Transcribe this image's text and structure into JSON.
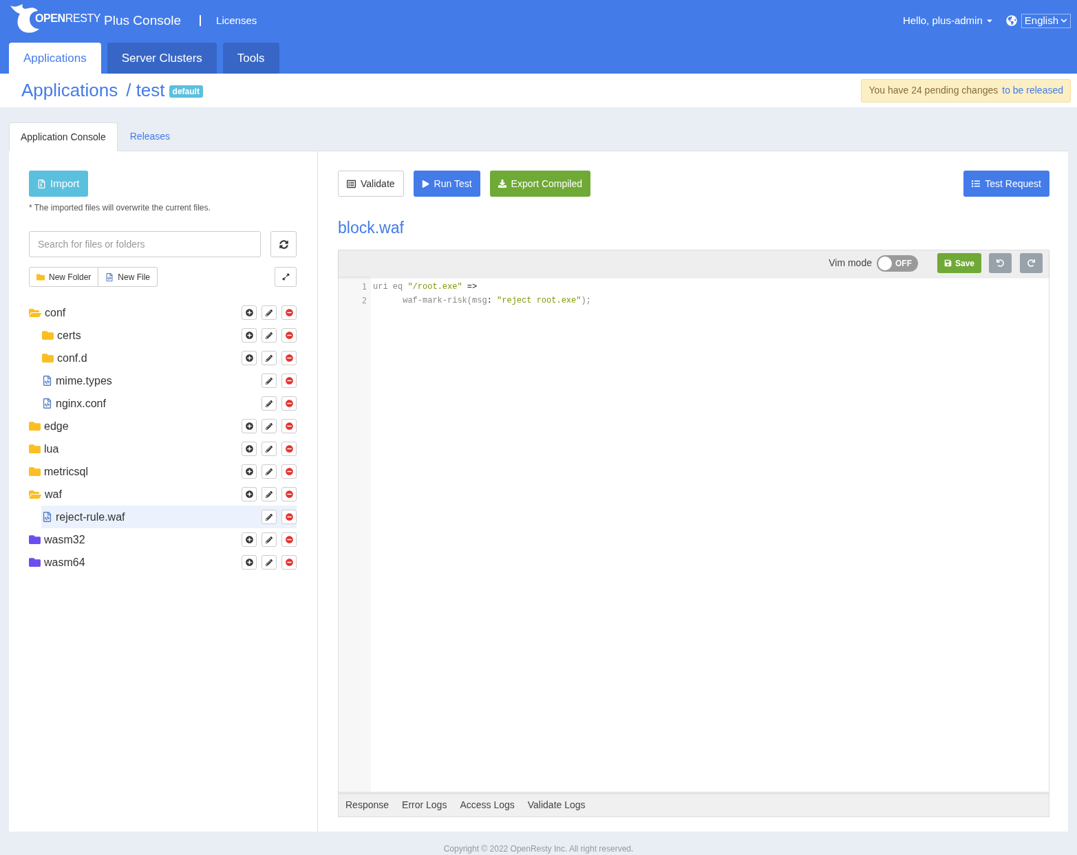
{
  "header": {
    "logo_text": "**OPEN**RESTY",
    "app_title": "Plus Console",
    "nav_link": "Licenses",
    "user_menu": "Hello, plus-admin",
    "language": "English"
  },
  "main_tabs": [
    {
      "label": "Applications",
      "selected": true
    },
    {
      "label": "Server Clusters",
      "selected": false
    },
    {
      "label": "Tools",
      "selected": false
    }
  ],
  "breadcrumb": {
    "root": "Applications",
    "current": "/ test",
    "badge": "default"
  },
  "notice": {
    "text": "You have 24 pending changes",
    "link": "to be released"
  },
  "sub_tabs": [
    {
      "label": "Application Console",
      "selected": true
    },
    {
      "label": "Releases",
      "selected": false
    }
  ],
  "sidebar": {
    "import_button": "Import",
    "import_note": "* The imported files will overwrite the current files.",
    "search": {
      "placeholder": "Search for files or folders"
    },
    "new_folder": "New Folder",
    "new_file": "New File",
    "tree": [
      {
        "name": "conf",
        "kind": "folder",
        "expanded": true,
        "selected": false,
        "children": [
          {
            "name": "certs",
            "kind": "folder",
            "expanded": false,
            "selected": false
          },
          {
            "name": "conf.d",
            "kind": "folder",
            "expanded": false,
            "selected": false
          },
          {
            "name": "mime.types",
            "kind": "file",
            "selected": false
          },
          {
            "name": "nginx.conf",
            "kind": "file",
            "selected": false
          }
        ]
      },
      {
        "name": "edge",
        "kind": "folder",
        "expanded": false,
        "selected": false
      },
      {
        "name": "lua",
        "kind": "folder",
        "expanded": false,
        "selected": false
      },
      {
        "name": "metricsql",
        "kind": "folder",
        "expanded": false,
        "selected": false
      },
      {
        "name": "waf",
        "kind": "folder",
        "expanded": true,
        "selected": false,
        "children": [
          {
            "name": "reject-rule.waf",
            "kind": "file",
            "selected": true
          }
        ]
      },
      {
        "name": "wasm32",
        "kind": "wasm",
        "selected": false
      },
      {
        "name": "wasm64",
        "kind": "wasm",
        "selected": false
      }
    ]
  },
  "toolbar": {
    "validate": "Validate",
    "run_test": "Run Test",
    "export": "Export Compiled",
    "test_request": "Test Request"
  },
  "editor": {
    "file_title": "block.waf",
    "vim_label": "Vim mode",
    "vim_on": false,
    "vim_state": "OFF",
    "save": "Save",
    "lines": [
      {
        "number": "1",
        "tokens": [
          {
            "text": "uri eq ",
            "kind": "plain"
          },
          {
            "text": "\"/root.exe\"",
            "kind": "string"
          },
          {
            "text": " =>",
            "kind": "op"
          }
        ]
      },
      {
        "number": "2",
        "tokens": [
          {
            "text": "      waf-mark-risk(msg",
            "kind": "plain"
          },
          {
            "text": ": ",
            "kind": "op"
          },
          {
            "text": "\"reject root.exe\"",
            "kind": "string"
          },
          {
            "text": ");",
            "kind": "plain"
          }
        ]
      }
    ]
  },
  "log_tabs": [
    {
      "label": "Response",
      "selected": false
    },
    {
      "label": "Error Logs",
      "selected": false
    },
    {
      "label": "Access Logs",
      "selected": false
    },
    {
      "label": "Validate Logs",
      "selected": false
    }
  ],
  "footer": "Copyright © 2022 OpenResty Inc. All right reserved."
}
